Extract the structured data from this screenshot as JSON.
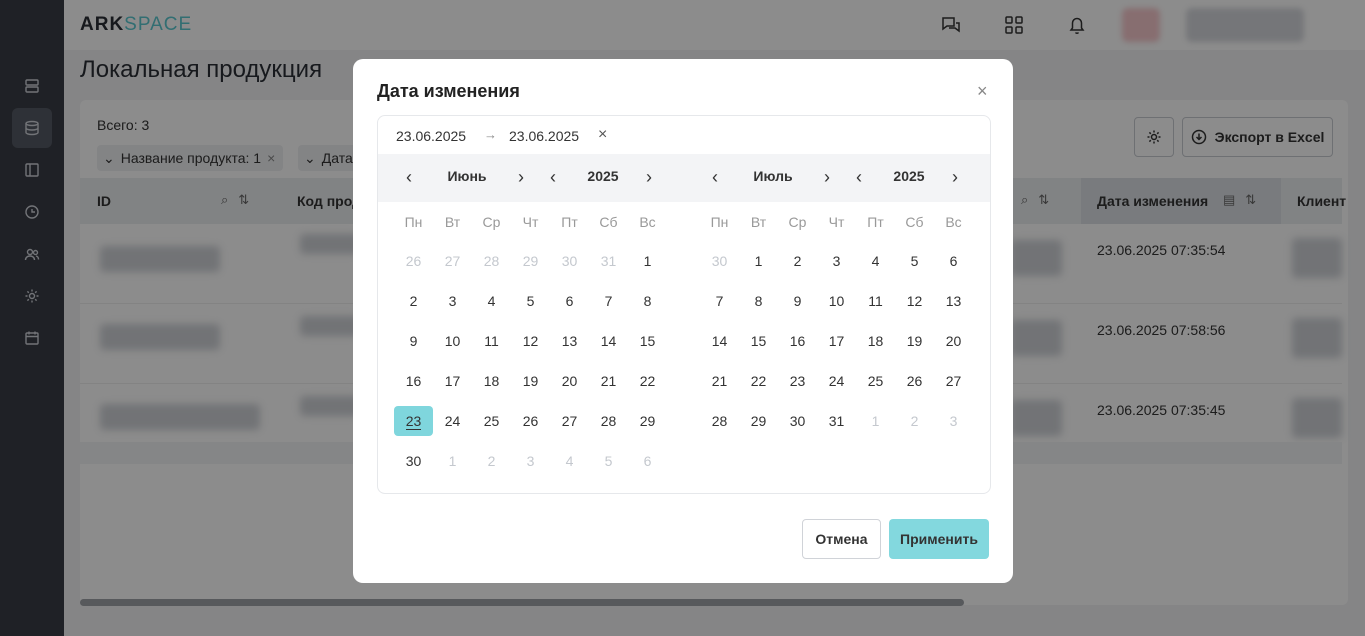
{
  "app": {
    "logo_a": "ARK",
    "logo_b": "SPACE"
  },
  "sidebar": {
    "items": [
      "server-icon",
      "database-icon",
      "layout-icon",
      "clock-icon",
      "users-icon",
      "gear-icon",
      "calendar-icon"
    ]
  },
  "page": {
    "title": "Локальная продукция"
  },
  "toolbar": {
    "total": "Всего: 3",
    "chip1": "Название продукта: 1",
    "chip2": "Дата",
    "export_label": "Экспорт в Excel"
  },
  "table": {
    "headers": {
      "id": "ID",
      "code": "Код прод",
      "date": "Дата изменения",
      "client": "Клиент"
    },
    "rows": [
      {
        "date": "23.06.2025 07:35:54"
      },
      {
        "date": "23.06.2025 07:58:56"
      },
      {
        "date": "23.06.2025 07:35:45"
      }
    ]
  },
  "modal": {
    "title": "Дата изменения",
    "close": "×",
    "range_start": "23.06.2025",
    "range_arrow": "→",
    "range_end": "23.06.2025",
    "range_clear": "×",
    "cancel_label": "Отмена",
    "apply_label": "Применить",
    "weekdays": [
      "Пн",
      "Вт",
      "Ср",
      "Чт",
      "Пт",
      "Сб",
      "Вс"
    ],
    "left": {
      "month": "Июнь",
      "year": "2025",
      "days": [
        "26",
        "27",
        "28",
        "29",
        "30",
        "31",
        "1",
        "2",
        "3",
        "4",
        "5",
        "6",
        "7",
        "8",
        "9",
        "10",
        "11",
        "12",
        "13",
        "14",
        "15",
        "16",
        "17",
        "18",
        "19",
        "20",
        "21",
        "22",
        "23",
        "24",
        "25",
        "26",
        "27",
        "28",
        "29",
        "30",
        "1",
        "2",
        "3",
        "4",
        "5",
        "6"
      ],
      "muted": [
        0,
        1,
        2,
        3,
        4,
        5,
        36,
        37,
        38,
        39,
        40,
        41
      ],
      "selected": 28
    },
    "right": {
      "month": "Июль",
      "year": "2025",
      "days": [
        "30",
        "1",
        "2",
        "3",
        "4",
        "5",
        "6",
        "7",
        "8",
        "9",
        "10",
        "11",
        "12",
        "13",
        "14",
        "15",
        "16",
        "17",
        "18",
        "19",
        "20",
        "21",
        "22",
        "23",
        "24",
        "25",
        "26",
        "27",
        "28",
        "29",
        "30",
        "31",
        "1",
        "2",
        "3"
      ],
      "muted": [
        0,
        32,
        33,
        34
      ],
      "selected": -1
    }
  },
  "colors": {
    "accent": "#7fd6dd",
    "sidebar": "#3a3d45"
  }
}
